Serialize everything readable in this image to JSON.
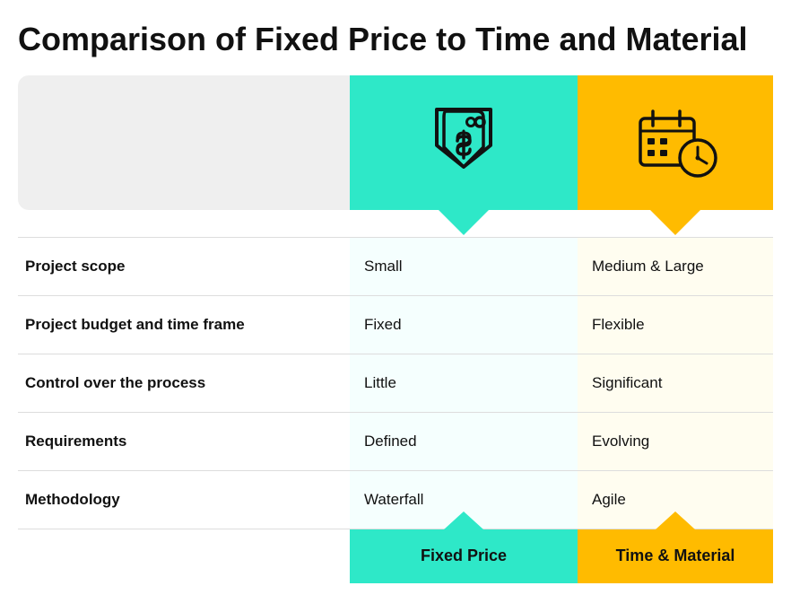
{
  "page": {
    "title": "Comparison of Fixed Price to Time and Material"
  },
  "columns": {
    "fp_label": "Fixed Price",
    "tm_label": "Time & Material"
  },
  "rows": [
    {
      "attribute": "Project scope",
      "fp_value": "Small",
      "tm_value": "Medium & Large"
    },
    {
      "attribute": "Project budget and time frame",
      "fp_value": "Fixed",
      "tm_value": "Flexible"
    },
    {
      "attribute": "Control over the process",
      "fp_value": "Little",
      "tm_value": "Significant"
    },
    {
      "attribute": "Requirements",
      "fp_value": "Defined",
      "tm_value": "Evolving"
    },
    {
      "attribute": "Methodology",
      "fp_value": "Waterfall",
      "tm_value": "Agile"
    }
  ],
  "colors": {
    "fp_accent": "#2ee8c8",
    "tm_accent": "#ffbb00",
    "bg_label": "#efefef",
    "text_dark": "#111111"
  }
}
